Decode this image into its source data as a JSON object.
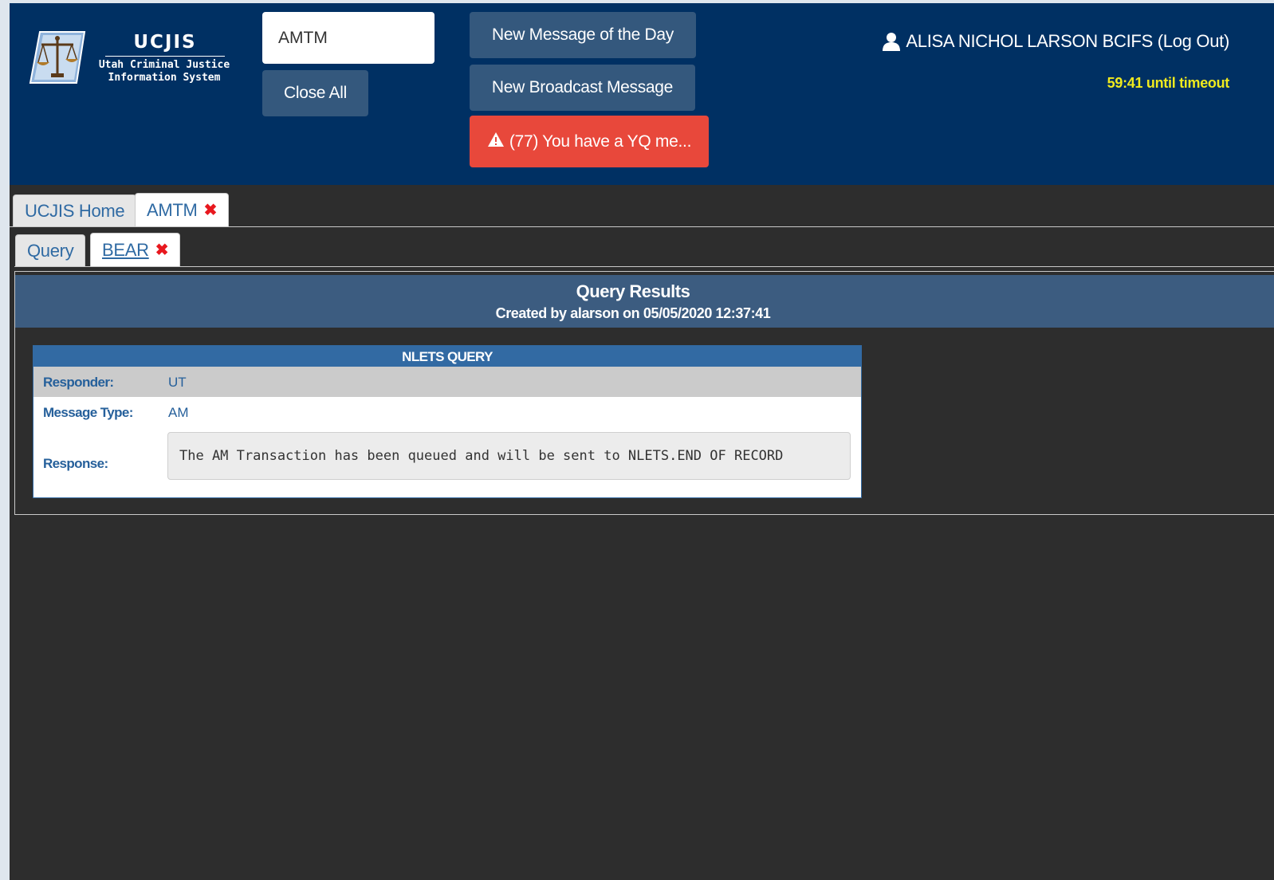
{
  "header": {
    "logo": {
      "title": "UCJIS",
      "subtitle_line1": "Utah Criminal Justice",
      "subtitle_line2": "Information System"
    },
    "search_value": "AMTM",
    "close_all_label": "Close All",
    "motd_label": "New Message of the Day",
    "broadcast_label": "New Broadcast Message",
    "alert": {
      "icon": "warning-triangle-icon",
      "label": "(77) You have a YQ me..."
    },
    "user": {
      "icon": "user-icon",
      "name": "ALISA NICHOL LARSON BCIFS",
      "logout_label": "(Log Out)"
    },
    "timeout_text": "59:41 until timeout"
  },
  "top_tabs": [
    {
      "label": "UCJIS Home",
      "active": false,
      "closable": false
    },
    {
      "label": "AMTM",
      "active": true,
      "closable": true
    }
  ],
  "sub_tabs": [
    {
      "label": "Query",
      "active": false,
      "closable": false
    },
    {
      "label": "BEAR",
      "active": true,
      "closable": true
    }
  ],
  "close_glyph": "✖",
  "results": {
    "title": "Query Results",
    "subtitle": "Created by alarson on 05/05/2020 12:37:41",
    "nlets": {
      "title": "NLETS QUERY",
      "rows": [
        {
          "label": "Responder:",
          "value": "UT"
        },
        {
          "label": "Message Type:",
          "value": "AM"
        },
        {
          "label": "Response:",
          "value": "The AM Transaction has been queued and will be sent to NLETS.END OF RECORD"
        }
      ]
    }
  },
  "colors": {
    "header_bg": "#003063",
    "button_bg": "#34587d",
    "alert_bg": "#e8483b",
    "timeout": "#f0ea1e",
    "tab_text": "#2f6aa3",
    "close_x": "#e8181e",
    "content_bg": "#2d2d2d",
    "results_header_bg": "#3c5c80",
    "nlets_header_bg": "#326aa3"
  }
}
